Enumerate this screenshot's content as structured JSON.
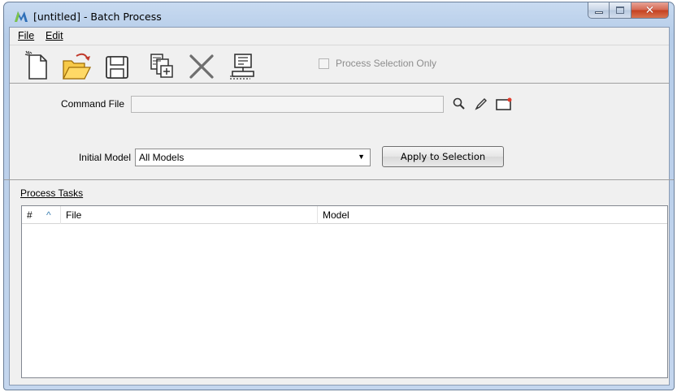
{
  "window": {
    "title": "[untitled] - Batch Process"
  },
  "menu": {
    "file": "File",
    "edit": "Edit"
  },
  "toolbar": {
    "process_selection_only": "Process Selection Only"
  },
  "form": {
    "command_file_label": "Command File",
    "command_file_value": "",
    "initial_model_label": "Initial Model",
    "initial_model_value": "All Models",
    "apply_button": "Apply to Selection"
  },
  "tasks": {
    "label": "Process Tasks",
    "columns": [
      "#",
      "File",
      "Model"
    ],
    "rows": []
  },
  "colors": {
    "accent": "#3c7fb1",
    "close": "#c4401f"
  }
}
